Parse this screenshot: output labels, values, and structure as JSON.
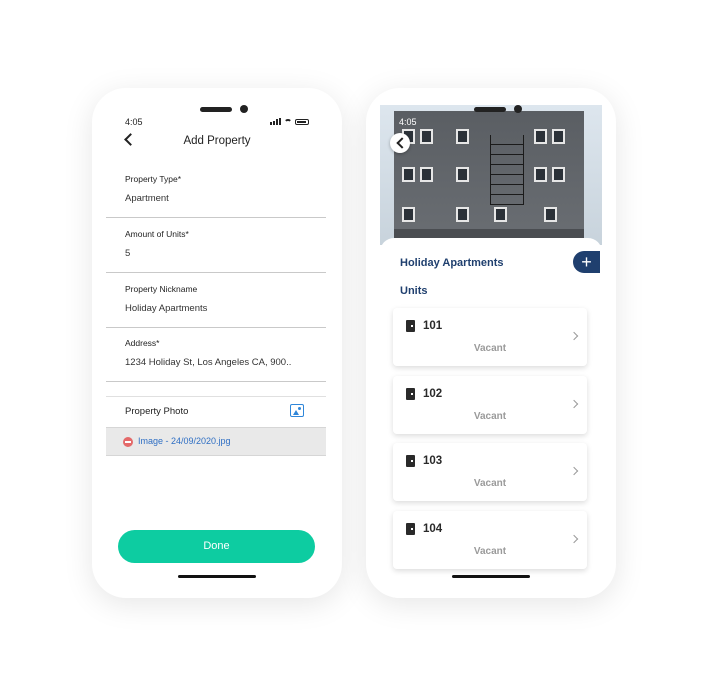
{
  "add_property": {
    "status_time": "4:05",
    "title": "Add Property",
    "fields": [
      {
        "label": "Property Type*",
        "value": "Apartment"
      },
      {
        "label": "Amount of Units*",
        "value": "5"
      },
      {
        "label": "Property Nickname",
        "value": "Holiday Apartments"
      },
      {
        "label": "Address*",
        "value": "1234 Holiday St, Los Angeles CA, 900.."
      }
    ],
    "photo_label": "Property Photo",
    "attachment": "Image - 24/09/2020.jpg",
    "done_label": "Done"
  },
  "property_detail": {
    "status_time": "4:05",
    "property_name": "Holiday Apartments",
    "add_label": "+",
    "units_title": "Units",
    "units": [
      {
        "number": "101",
        "status": "Vacant"
      },
      {
        "number": "102",
        "status": "Vacant"
      },
      {
        "number": "103",
        "status": "Vacant"
      },
      {
        "number": "104",
        "status": "Vacant"
      }
    ]
  },
  "colors": {
    "accent_green": "#0dcca1",
    "navy": "#1f3f6e",
    "link_blue": "#2f6fc4",
    "remove_red": "#e46969"
  }
}
